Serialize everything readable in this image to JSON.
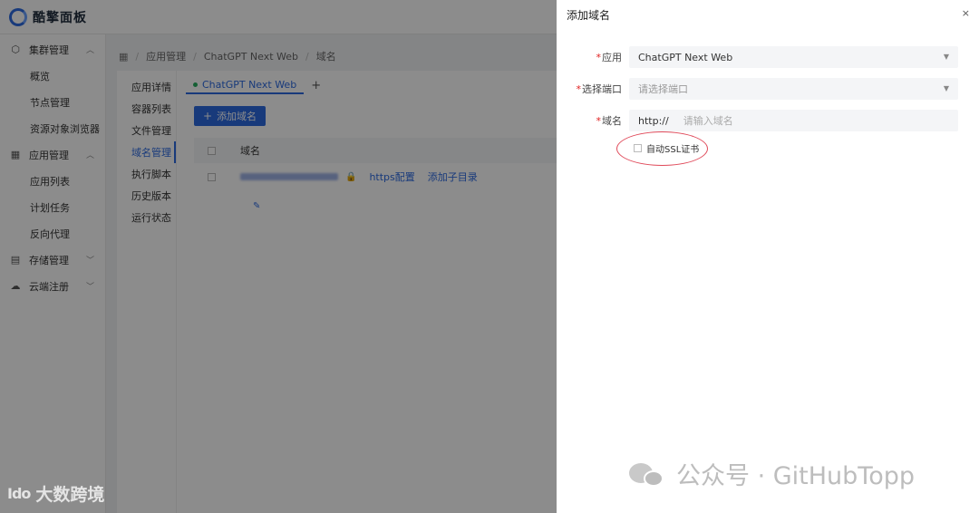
{
  "app": {
    "title": "酷擎面板"
  },
  "sidebar": {
    "groups": [
      {
        "label": "集群管理",
        "icon": "cube-icon",
        "chevron": "up",
        "items": [
          "概览",
          "节点管理",
          "资源对象浏览器"
        ]
      },
      {
        "label": "应用管理",
        "icon": "grid-icon",
        "chevron": "up",
        "items": [
          "应用列表",
          "计划任务",
          "反向代理"
        ]
      },
      {
        "label": "存储管理",
        "icon": "storage-icon",
        "chevron": "down",
        "items": []
      },
      {
        "label": "云端注册",
        "icon": "cloud-icon",
        "chevron": "down",
        "items": []
      }
    ]
  },
  "breadcrumb": [
    "应用管理",
    "ChatGPT Next Web",
    "域名"
  ],
  "subnav": {
    "items": [
      "应用详情",
      "容器列表",
      "文件管理",
      "域名管理",
      "执行脚本",
      "历史版本",
      "运行状态"
    ],
    "active_index": 3
  },
  "tabs": [
    {
      "label": "ChatGPT Next Web",
      "status_color": "#27ae60"
    }
  ],
  "tab_add_label": "+",
  "add_domain_button": "添加域名",
  "table": {
    "header": "域名",
    "rows": [
      {
        "https_link": "https配置",
        "subdir_link": "添加子目录"
      }
    ]
  },
  "drawer": {
    "title": "添加域名",
    "close": "×",
    "fields": {
      "app": {
        "label": "应用",
        "value": "ChatGPT Next Web"
      },
      "port": {
        "label": "选择端口",
        "placeholder": "请选择端口"
      },
      "domain": {
        "label": "域名",
        "prefix": "http://",
        "placeholder": "请输入域名"
      }
    },
    "ssl_checkbox": {
      "label": "自动SSL证书",
      "checked": false
    }
  },
  "watermarks": {
    "right": "公众号 · GitHubTopp",
    "left_mark": "Ido",
    "left": "大数跨境"
  },
  "colors": {
    "accent": "#2d6ae0",
    "required": "#e02020",
    "highlight": "#e04a5a"
  }
}
